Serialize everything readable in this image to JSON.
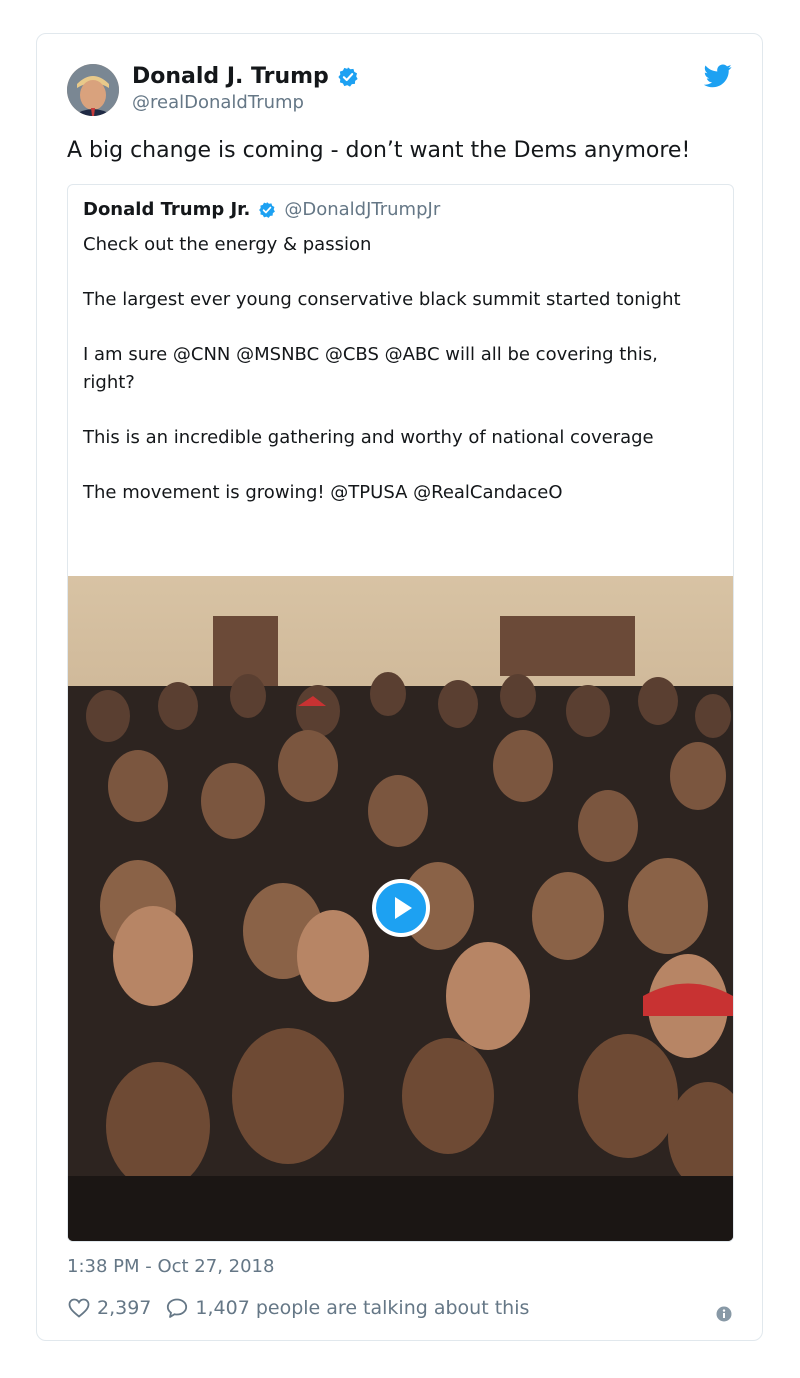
{
  "tweet": {
    "author_name": "Donald J. Trump",
    "author_handle": "@realDonaldTrump",
    "text": "A big change is coming - don’t want the Dems anymore!",
    "timestamp": "1:38 PM - Oct 27, 2018",
    "likes": "2,397",
    "replies_text": "1,407 people are talking about this"
  },
  "quoted": {
    "author_name": "Donald Trump Jr.",
    "author_handle": "@DonaldJTrumpJr",
    "paragraphs": [
      "Check out the energy & passion",
      "The largest ever young conservative black summit started tonight",
      "I am sure @CNN @MSNBC @CBS @ABC will all be covering this, right?",
      "This is an incredible gathering and worthy of national coverage",
      "The movement is growing! @TPUSA @RealCandaceO"
    ]
  },
  "icons": {
    "verified": "verified-badge-icon",
    "bird": "twitter-bird-icon",
    "play": "play-icon",
    "heart": "heart-icon",
    "comment": "comment-icon",
    "info": "info-icon"
  },
  "colors": {
    "accent": "#1da1f2",
    "muted": "#657786",
    "border": "#e1e8ed"
  }
}
